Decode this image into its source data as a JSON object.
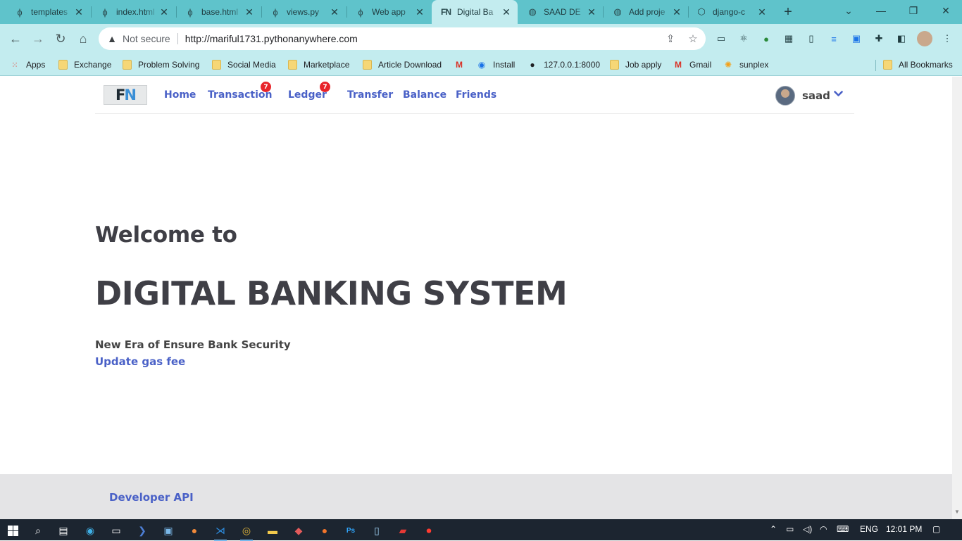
{
  "browser": {
    "tabs": [
      {
        "title": "templates",
        "icon": "pythonanywhere-icon",
        "active": false
      },
      {
        "title": "index.html",
        "icon": "pythonanywhere-icon",
        "active": false
      },
      {
        "title": "base.html",
        "icon": "pythonanywhere-icon",
        "active": false
      },
      {
        "title": "views.py",
        "icon": "pythonanywhere-icon",
        "active": false
      },
      {
        "title": "Web app",
        "icon": "pythonanywhere-icon",
        "active": false
      },
      {
        "title": "Digital Ba",
        "icon": "fn-logo-icon",
        "active": true
      },
      {
        "title": "SAAD DE",
        "icon": "globe-icon",
        "active": false
      },
      {
        "title": "Add proje",
        "icon": "globe-icon",
        "active": false
      },
      {
        "title": "django-c",
        "icon": "cube-icon",
        "active": false
      }
    ],
    "new_tab_label": "+",
    "security_label": "Not secure",
    "url": "http://mariful1731.pythonanywhere.com",
    "bookmarks": [
      {
        "label": "Apps",
        "icon": "apps-grid-icon"
      },
      {
        "label": "Exchange",
        "icon": "folder-icon"
      },
      {
        "label": "Problem Solving",
        "icon": "folder-icon"
      },
      {
        "label": "Social Media",
        "icon": "folder-icon"
      },
      {
        "label": "Marketplace",
        "icon": "folder-icon"
      },
      {
        "label": "Article Download",
        "icon": "folder-icon"
      },
      {
        "label": "",
        "icon": "gmail-icon"
      },
      {
        "label": "Install",
        "icon": "install-icon"
      },
      {
        "label": "127.0.0.1:8000",
        "icon": "globe-icon"
      },
      {
        "label": "Job apply",
        "icon": "folder-icon"
      },
      {
        "label": "Gmail",
        "icon": "gmail-icon"
      },
      {
        "label": "sunplex",
        "icon": "sun-icon"
      }
    ],
    "all_bookmarks_label": "All Bookmarks"
  },
  "site": {
    "logo_text_a": "F",
    "logo_text_b": "N",
    "nav": {
      "home": "Home",
      "transaction": "Transaction",
      "transaction_badge": "7",
      "ledger": "Ledger",
      "ledger_badge": "7",
      "transfer": "Transfer",
      "balance": "Balance",
      "friends": "Friends"
    },
    "user": {
      "name": "saad"
    },
    "hero": {
      "welcome": "Welcome to",
      "title": "DIGITAL BANKING SYSTEM",
      "subtitle": "New Era of Ensure Bank Security",
      "link": "Update gas fee"
    },
    "footer": {
      "link": "Developer API"
    }
  },
  "taskbar": {
    "language": "ENG",
    "time": "12:01 PM"
  },
  "colors": {
    "tabstrip": "#5fc3cb",
    "toolbar": "#c3ecef",
    "link": "#4a61c7",
    "badge": "#e8242a",
    "heading": "#3f3f46",
    "footer": "#e4e4e6",
    "taskbar": "#1c2530"
  }
}
